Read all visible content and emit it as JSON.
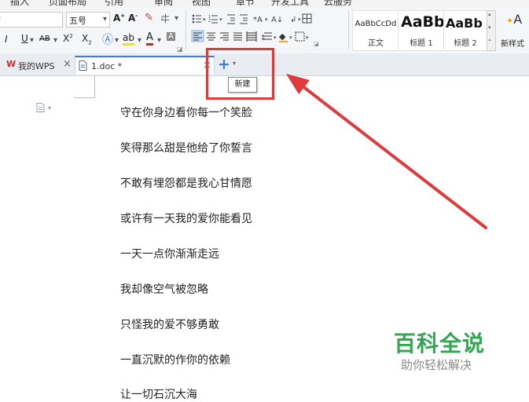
{
  "menu": {
    "items": [
      "插入",
      "页面布局",
      "引用",
      "审阅",
      "视图",
      "章节",
      "开发工具",
      "云服务"
    ]
  },
  "ribbon": {
    "font_size": "五号",
    "styles": [
      {
        "sample": "AaBbCcDd",
        "name": "正文"
      },
      {
        "sample": "AaBb",
        "name": "标题 1"
      },
      {
        "sample": "AaBb",
        "name": "标题 2"
      }
    ],
    "new_style_label": "新样式"
  },
  "tabs": {
    "mywps_label": "我的WPS",
    "doc_label": "1.doc *"
  },
  "tooltip": {
    "text": "新建"
  },
  "document": {
    "lines": [
      "守在你身边看你每一个笑脸",
      "笑得那么甜是他给了你誓言",
      "不敢有埋怨都是我心甘情愿",
      "或许有一天我的爱你能看见",
      "一天一点你渐渐走远",
      "我却像空气被忽略",
      "只怪我的爱不够勇敢",
      "一直沉默的作你的依赖",
      "让一切石沉大海"
    ]
  },
  "watermark": {
    "title": "百科全说",
    "subtitle": "助你轻松解决"
  },
  "colors": {
    "highlight": "#e03a3a",
    "accent": "#3b7ddd",
    "watermark_green": "#2fa84f"
  }
}
